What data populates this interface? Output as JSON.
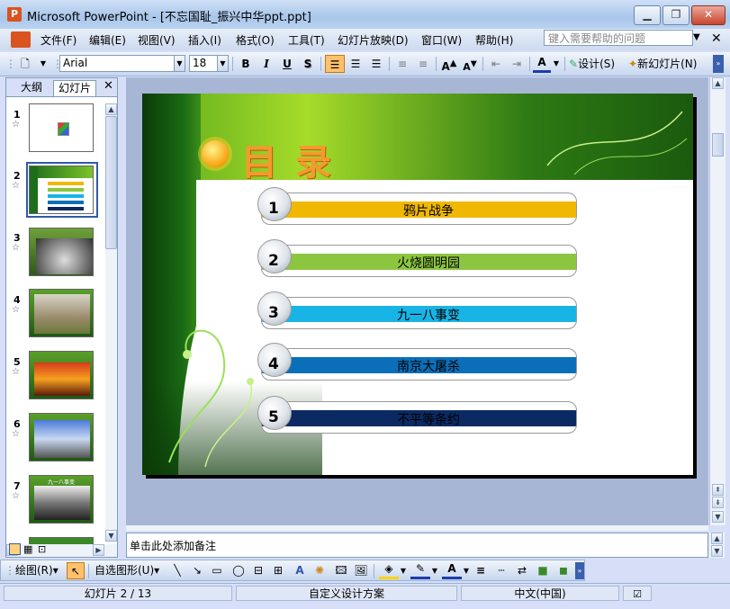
{
  "window": {
    "title": "Microsoft PowerPoint - [不忘国耻_振兴中华ppt.ppt]",
    "app_icon": "P"
  },
  "menu": {
    "items": [
      "文件(F)",
      "编辑(E)",
      "视图(V)",
      "插入(I)",
      "格式(O)",
      "工具(T)",
      "幻灯片放映(D)",
      "窗口(W)",
      "帮助(H)"
    ],
    "help_placeholder": "键入需要帮助的问题"
  },
  "toolbar": {
    "font_name": "Arial",
    "font_size": "18",
    "bold": "B",
    "italic": "I",
    "underline": "U",
    "shadow": "S",
    "design_label": "设计(S)",
    "new_slide_label": "新幻灯片(N)"
  },
  "panel": {
    "tabs": [
      "大纲",
      "幻灯片"
    ],
    "active_tab": "幻灯片",
    "slide_numbers": [
      "1",
      "2",
      "3",
      "4",
      "5",
      "6",
      "7"
    ],
    "thumb_7_caption": "九一八事变"
  },
  "slide": {
    "title": "目录",
    "items": [
      {
        "num": "1",
        "label": "鸦片战争",
        "color": "#f0b800"
      },
      {
        "num": "2",
        "label": "火烧圆明园",
        "color": "#8cc63f"
      },
      {
        "num": "3",
        "label": "九一八事变",
        "color": "#19b4e6"
      },
      {
        "num": "4",
        "label": "南京大屠杀",
        "color": "#0a6fb8"
      },
      {
        "num": "5",
        "label": "不平等条约",
        "color": "#0b2a63"
      }
    ]
  },
  "notes": {
    "placeholder": "单击此处添加备注"
  },
  "drawbar": {
    "draw_label": "绘图(R)",
    "autoshapes_label": "自选图形(U)"
  },
  "status": {
    "slide_info": "幻灯片 2 / 13",
    "design": "自定义设计方案",
    "language": "中文(中国)"
  }
}
